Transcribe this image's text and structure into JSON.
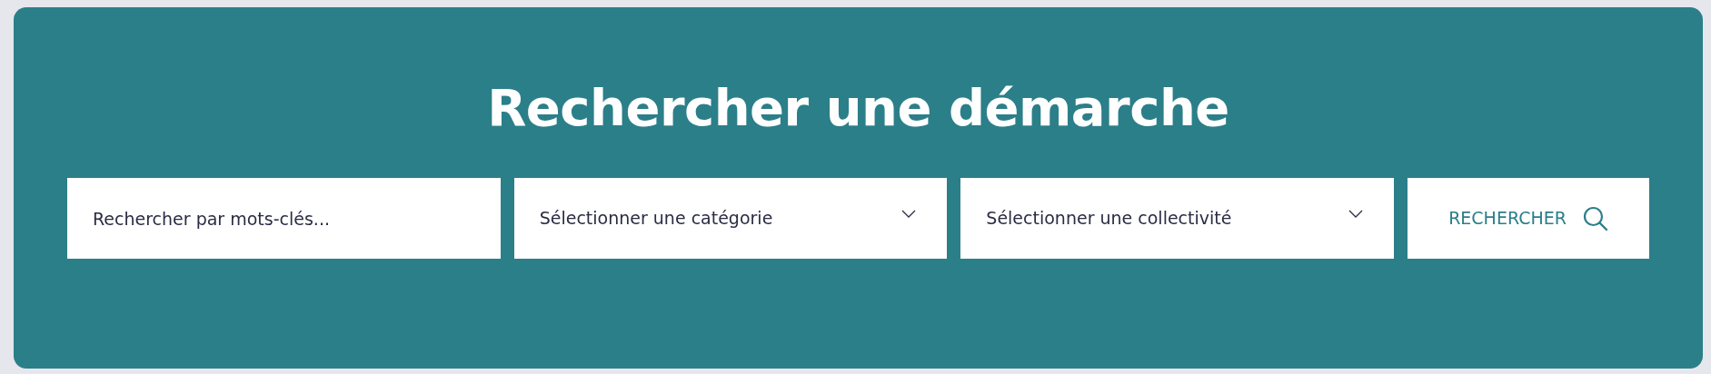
{
  "title": "Rechercher une démarche",
  "fields": [
    {
      "kind": "text",
      "placeholder": "Rechercher par mots-clés..."
    },
    {
      "kind": "select",
      "label": "Sélectionner une catégorie"
    },
    {
      "kind": "select",
      "label": "Sélectionner une collectivité"
    }
  ],
  "search_button": {
    "label": "RECHERCHER"
  }
}
